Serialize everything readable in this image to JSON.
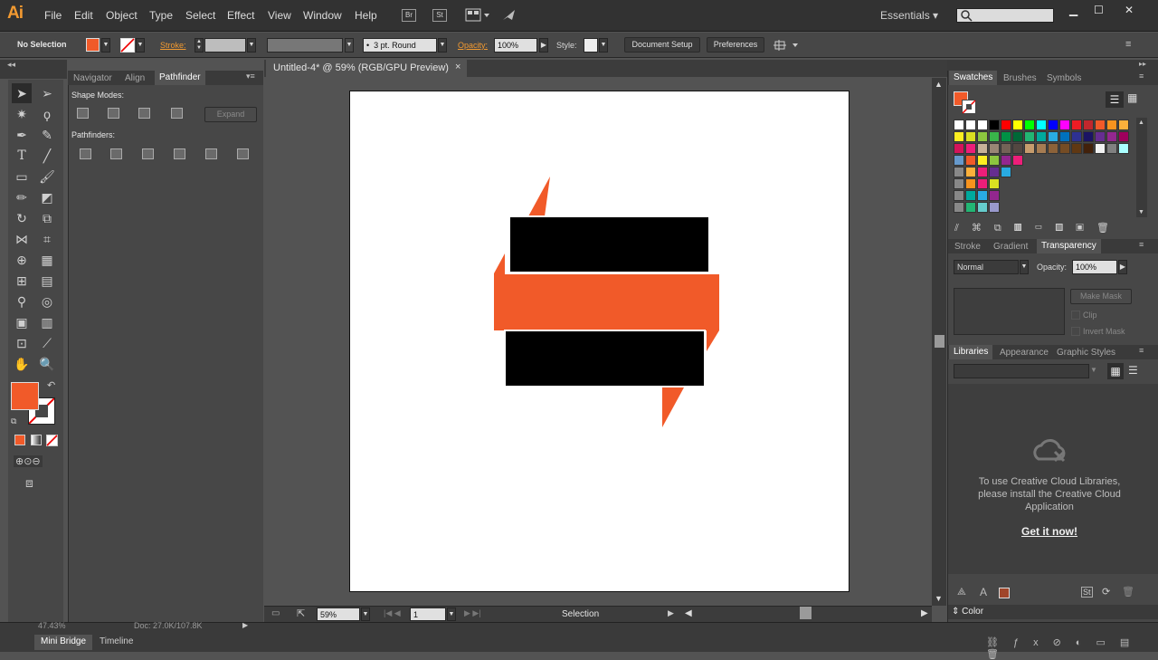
{
  "app": {
    "logo": "Ai"
  },
  "menu": [
    "File",
    "Edit",
    "Object",
    "Type",
    "Select",
    "Effect",
    "View",
    "Window",
    "Help"
  ],
  "menu_icons": {
    "bridge": "Br",
    "stock": "St"
  },
  "workspace": "Essentials",
  "ctrl": {
    "selection_label": "No Selection",
    "stroke_label": "Stroke:",
    "brush_value": "3 pt. Round",
    "opacity_label": "Opacity:",
    "opacity_value": "100%",
    "style_label": "Style:",
    "doc_setup": "Document Setup",
    "preferences": "Preferences"
  },
  "doc": {
    "tab_title": "Untitled-4* @ 59% (RGB/GPU Preview)",
    "close": "×"
  },
  "colors": {
    "orange": "#f15a29",
    "black": "#000000",
    "panel": "#474747",
    "accent": "#f29a31"
  },
  "status": {
    "zoom": "59%",
    "page": "1",
    "tool": "Selection",
    "left_frag": "47.43%",
    "doc_frag": "Doc: 27.0K/107.8K"
  },
  "left_panel": {
    "tabs": [
      "Navigator",
      "Align",
      "Pathfinder"
    ],
    "shape_modes": "Shape Modes:",
    "pathfinders": "Pathfinders:",
    "expand": "Expand"
  },
  "right_panel": {
    "swatch_tabs": [
      "Swatches",
      "Brushes",
      "Symbols"
    ],
    "trans_tabs": [
      "Stroke",
      "Gradient",
      "Transparency"
    ],
    "blend": "Normal",
    "opacity_label": "Opacity:",
    "opacity_value": "100%",
    "make_mask": "Make Mask",
    "clip": "Clip",
    "invert": "Invert Mask",
    "lib_tabs": [
      "Libraries",
      "Appearance",
      "Graphic Styles"
    ],
    "lib_msg1": "To use Creative Cloud Libraries,",
    "lib_msg2": "please install the Creative Cloud",
    "lib_msg3": "Application",
    "get_it": "Get it now!",
    "color_tab": "Color"
  },
  "bottom": {
    "tabs": [
      "Mini Bridge",
      "Timeline"
    ]
  }
}
